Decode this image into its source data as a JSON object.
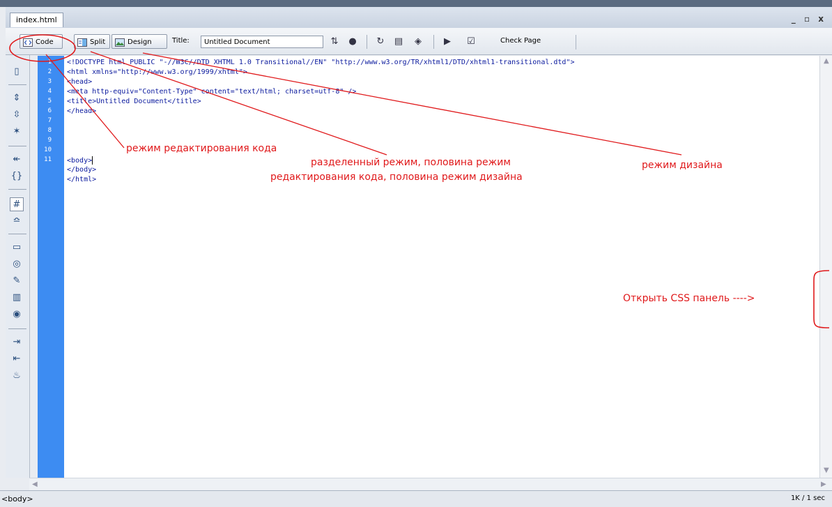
{
  "document": {
    "tab_title": "index.html",
    "window_controls": "_ ▫ x"
  },
  "toolbar": {
    "code_label": "Code",
    "split_label": "Split",
    "design_label": "Design",
    "title_label": "Title:",
    "title_value": "Untitled Document",
    "check_page_label": "Check Page",
    "icons": [
      "file-management-icon",
      "preview-browser-icon",
      "refresh-icon",
      "view-options-icon",
      "visual-aids-icon",
      "validate-markup-icon",
      "check-page-icon"
    ]
  },
  "left_toolbar": {
    "icons": [
      "open-documents-icon",
      "collapse-tag-icon",
      "collapse-selection-icon",
      "expand-all-icon",
      "select-parent-tag-icon",
      "balance-braces-icon",
      "line-numbers-icon",
      "highlight-invalid-icon",
      "apply-comment-icon",
      "remove-comment-icon",
      "wrap-tag-icon",
      "recent-snippets-icon",
      "move-css-icon",
      "indent-icon",
      "outdent-icon",
      "format-source-icon"
    ]
  },
  "editor": {
    "line_numbers": [
      "1",
      "2",
      "3",
      "4",
      "5",
      "6",
      "7",
      "8",
      "9",
      "10",
      "11"
    ],
    "lines": [
      "<!DOCTYPE html PUBLIC \"-//W3C//DTD XHTML 1.0 Transitional//EN\" \"http://www.w3.org/TR/xhtml1/DTD/xhtml1-transitional.dtd\">",
      "<html xmlns=\"http://www.w3.org/1999/xhtml\">",
      "<head>",
      "<meta http-equiv=\"Content-Type\" content=\"text/html; charset=utf-8\" />",
      "<title>Untitled Document</title>",
      "</head>",
      "",
      "<body>",
      "</body>",
      "</html>",
      ""
    ]
  },
  "status_bar": {
    "tag_selector": "<body>",
    "file_info": "1K / 1 sec"
  },
  "annotations": {
    "code_mode": "режим редактирования кода",
    "split_mode_line1": "разделенный режим, половина режим",
    "split_mode_line2": "редактирования  кода, половина режим дизайна",
    "design_mode": "режим дизайна",
    "css_panel": "Открыть CSS панель ---->"
  },
  "colors": {
    "annotation": "#e0191b",
    "gutter": "#3d8cf2",
    "code_text": "#0b1a9e"
  }
}
